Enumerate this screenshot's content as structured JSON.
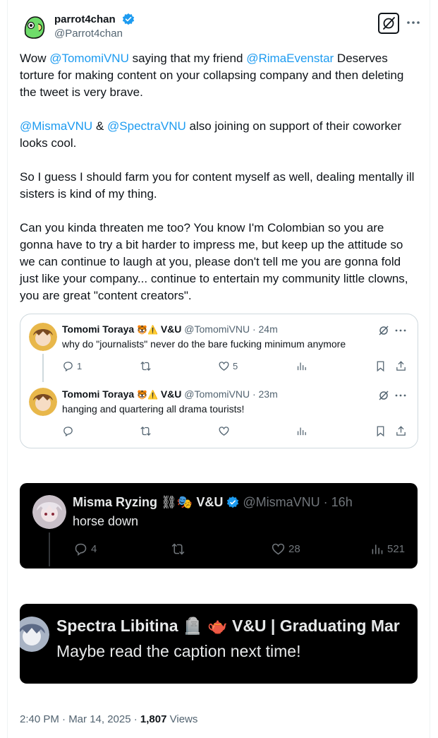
{
  "author": {
    "name": "parrot4chan",
    "handle": "@Parrot4chan"
  },
  "post": {
    "p1": {
      "t1": "Wow ",
      "m1": "@TomomiVNU",
      "t2": " saying that my friend ",
      "m2": "@RimaEvenstar",
      "t3": " Deserves torture for making content on your collapsing company and then deleting the tweet is very brave."
    },
    "p2": {
      "m1": "@MismaVNU",
      "t1": " & ",
      "m2": "@SpectraVNU",
      "t2": " also joining on support of their coworker looks cool."
    },
    "p3": "So I guess I should farm you for content myself as well, dealing mentally ill sisters is kind of my thing.",
    "p4": "Can you kinda threaten me too? You know I'm Colombian so you are gonna have to try a bit harder to impress me, but keep up the attitude so we can continue to laugh at you, please don't tell me you are gonna fold just like your company... continue to entertain my community little clowns, you are great \"content creators\"."
  },
  "quoted_thread": [
    {
      "name": "Tomomi Toraya",
      "emoji": "🐯⚠️",
      "affil": "V&U",
      "handle": "@TomomiVNU",
      "time": "· 24m",
      "text": "why do \"journalists\" never do the bare fucking minimum anymore",
      "replies": "1",
      "likes": "5"
    },
    {
      "name": "Tomomi Toraya",
      "emoji": "🐯⚠️",
      "affil": "V&U",
      "handle": "@TomomiVNU",
      "time": "· 23m",
      "text": "hanging and quartering all drama tourists!",
      "replies": "",
      "likes": ""
    }
  ],
  "screenshot1": {
    "name": "Misma Ryzing",
    "emoji": "⛓🎭",
    "affil": "V&U",
    "handle": "@MismaVNU",
    "time": "· 16h",
    "text": "horse down",
    "replies": "4",
    "likes": "28",
    "views": "521"
  },
  "screenshot2": {
    "name": "Spectra Libitina 🪦 🫖 V&U | Graduating Mar",
    "text": "Maybe read the caption next time!"
  },
  "meta": {
    "time": "2:40 PM · Mar 14, 2025 · ",
    "views_count": "1,807",
    "views_label": " Views"
  },
  "colors": {
    "accent": "#1d9bf0",
    "text": "#0f1419",
    "secondary": "#536471"
  }
}
